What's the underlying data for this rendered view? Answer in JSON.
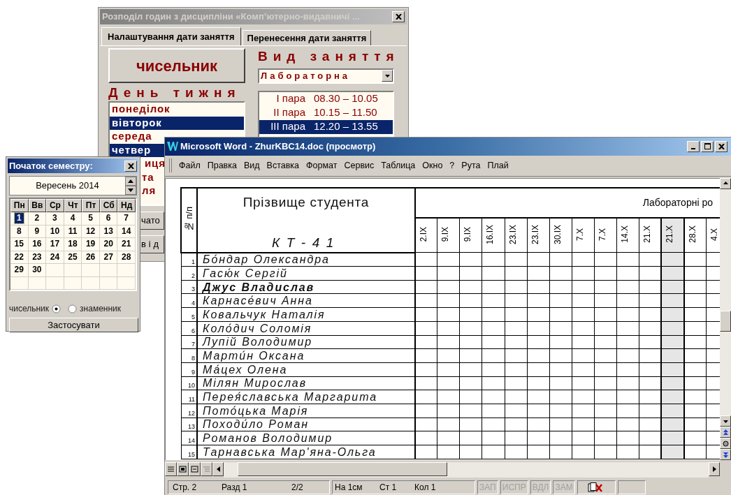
{
  "dialog": {
    "title": "Розподіл годин з дисципліни «Комп’ютерно-видавничі ...",
    "tabs": [
      {
        "label": "Налаштування дати заняття",
        "selected": true
      },
      {
        "label": "Перенесення дати заняття",
        "selected": false
      }
    ],
    "week_button": "чисельник",
    "lesson_type_label": "Вид заняття",
    "lesson_type_value": "Лабораторна",
    "day_label": "День тижня",
    "days": [
      {
        "text": "понеділок",
        "selected": false,
        "partial": false
      },
      {
        "text": "вівторок",
        "selected": true,
        "partial": false
      },
      {
        "text": "середа",
        "selected": false,
        "partial": false
      },
      {
        "text": "четвер",
        "selected": true,
        "partial": false
      },
      {
        "text": "иця",
        "selected": false,
        "partial": true
      },
      {
        "text": "та",
        "selected": false,
        "partial": true
      },
      {
        "text": "ля",
        "selected": false,
        "partial": true
      }
    ],
    "periods": [
      {
        "name": "I пара",
        "time": "08.30 – 10.05",
        "selected": false
      },
      {
        "name": "II пара",
        "time": "10.15 – 11.50",
        "selected": false
      },
      {
        "name": "III пара",
        "time": "12.20 – 13.55",
        "selected": true
      }
    ],
    "buttons": [
      "чато",
      "від"
    ]
  },
  "calendar": {
    "title": "Початок семестру:",
    "month": "Вересень 2014",
    "weekdays": [
      "Пн",
      "Вв",
      "Ср",
      "Чт",
      "Пт",
      "Сб",
      "Нд"
    ],
    "days": [
      {
        "label": "1",
        "selected": true
      },
      {
        "label": "2",
        "selected": false
      },
      {
        "label": "3",
        "selected": false
      },
      {
        "label": "4",
        "selected": false
      },
      {
        "label": "5",
        "selected": false
      },
      {
        "label": "6",
        "selected": false
      },
      {
        "label": "7",
        "selected": false
      },
      {
        "label": "8",
        "selected": false
      },
      {
        "label": "9",
        "selected": false
      },
      {
        "label": "10",
        "selected": false
      },
      {
        "label": "11",
        "selected": false
      },
      {
        "label": "12",
        "selected": false
      },
      {
        "label": "13",
        "selected": false
      },
      {
        "label": "14",
        "selected": false
      },
      {
        "label": "15",
        "selected": false
      },
      {
        "label": "16",
        "selected": false
      },
      {
        "label": "17",
        "selected": false
      },
      {
        "label": "18",
        "selected": false
      },
      {
        "label": "19",
        "selected": false
      },
      {
        "label": "20",
        "selected": false
      },
      {
        "label": "21",
        "selected": false
      },
      {
        "label": "22",
        "selected": false
      },
      {
        "label": "23",
        "selected": false
      },
      {
        "label": "24",
        "selected": false
      },
      {
        "label": "25",
        "selected": false
      },
      {
        "label": "26",
        "selected": false
      },
      {
        "label": "27",
        "selected": false
      },
      {
        "label": "28",
        "selected": false
      },
      {
        "label": "29",
        "selected": false
      },
      {
        "label": "30",
        "selected": false
      }
    ],
    "options": [
      {
        "label": "чисельник",
        "selected": true
      },
      {
        "label": "знаменник",
        "selected": false
      }
    ],
    "apply_button": "Застосувати"
  },
  "word": {
    "title": "Microsoft Word - ZhurKBC14.doc (просмотр)",
    "menu": [
      "Файл",
      "Правка",
      "Вид",
      "Вставка",
      "Формат",
      "Сервис",
      "Таблица",
      "Окно",
      "?",
      "Рута",
      "Плай"
    ],
    "table": {
      "number_header": "№ п/п",
      "name_header": "Прізвище студента",
      "group": "КТ-41",
      "lab_header": "Лабораторні ро",
      "dates": [
        {
          "label": "2.IX",
          "highlighted": false
        },
        {
          "label": "9.IX",
          "highlighted": false
        },
        {
          "label": "9.IX",
          "highlighted": false
        },
        {
          "label": "16.IX",
          "highlighted": false
        },
        {
          "label": "23.IX",
          "highlighted": false
        },
        {
          "label": "23.IX",
          "highlighted": false
        },
        {
          "label": "30.IX",
          "highlighted": false
        },
        {
          "label": "7.X",
          "highlighted": false
        },
        {
          "label": "7.X",
          "highlighted": false
        },
        {
          "label": "14.X",
          "highlighted": false
        },
        {
          "label": "21.X",
          "highlighted": false
        },
        {
          "label": "21.X",
          "highlighted": true
        },
        {
          "label": "28.X",
          "highlighted": false
        },
        {
          "label": "4.X",
          "highlighted": false
        }
      ],
      "rows": [
        {
          "number": "1",
          "name": "Бо́ндар Олександра",
          "bold": false
        },
        {
          "number": "2",
          "name": "Гасю́к Сергій",
          "bold": false
        },
        {
          "number": "3",
          "name": "Джус Владислав",
          "bold": true
        },
        {
          "number": "4",
          "name": "Карнасе́вич Анна",
          "bold": false
        },
        {
          "number": "5",
          "name": "Ковальчук Наталія",
          "bold": false
        },
        {
          "number": "6",
          "name": "Коло́дич Соломія",
          "bold": false
        },
        {
          "number": "7",
          "name": "Лупій Володимир",
          "bold": false
        },
        {
          "number": "8",
          "name": "Марти́н Оксана",
          "bold": false
        },
        {
          "number": "9",
          "name": "Ма́цех Олена",
          "bold": false
        },
        {
          "number": "10",
          "name": "Мілян Мирослав",
          "bold": false
        },
        {
          "number": "11",
          "name": "Перея́славська Маргарита",
          "bold": false
        },
        {
          "number": "12",
          "name": "Пото́цька Марія",
          "bold": false
        },
        {
          "number": "13",
          "name": "Походи́ло Роман",
          "bold": false
        },
        {
          "number": "14",
          "name": "Романов Володимир",
          "bold": false
        },
        {
          "number": "15",
          "name": "Тарнавська Мар'яна-Ольга",
          "bold": false
        }
      ]
    },
    "status_bar": {
      "page": "Стр. 2",
      "section": "Разд 1",
      "pages": "2/2",
      "at": "На 1см",
      "line": "Ст 1",
      "column": "Кол 1",
      "modes": [
        {
          "label": "ЗАП",
          "enabled": false
        },
        {
          "label": "ИСПР",
          "enabled": false
        },
        {
          "label": "ВДЛ",
          "enabled": false
        },
        {
          "label": "ЗАМ",
          "enabled": false
        }
      ]
    }
  }
}
